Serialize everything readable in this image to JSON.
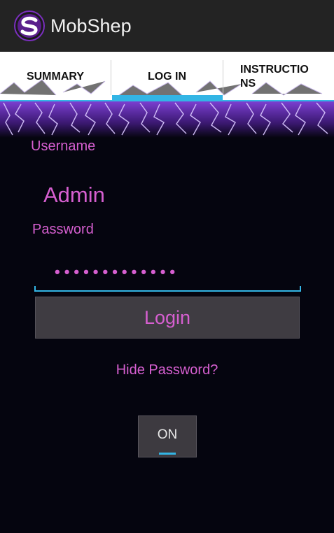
{
  "app": {
    "title": "MobShep",
    "icon": "mobshep-s-logo-icon"
  },
  "tabs": [
    {
      "label": "SUMMARY",
      "selected": false
    },
    {
      "label": "LOG IN",
      "selected": true
    },
    {
      "label": "INSTRUCTIO\nNS",
      "selected": false
    }
  ],
  "form": {
    "username_label": "Username",
    "username_value": "Admin",
    "password_label": "Password",
    "password_masked": "•••••••••••••",
    "login_label": "Login",
    "hide_password_label": "Hide Password?",
    "toggle_label": "ON"
  },
  "colors": {
    "accent": "#33b5e5",
    "text_pink": "#d65fd0",
    "background": "#05050f",
    "actionbar": "#232323"
  }
}
